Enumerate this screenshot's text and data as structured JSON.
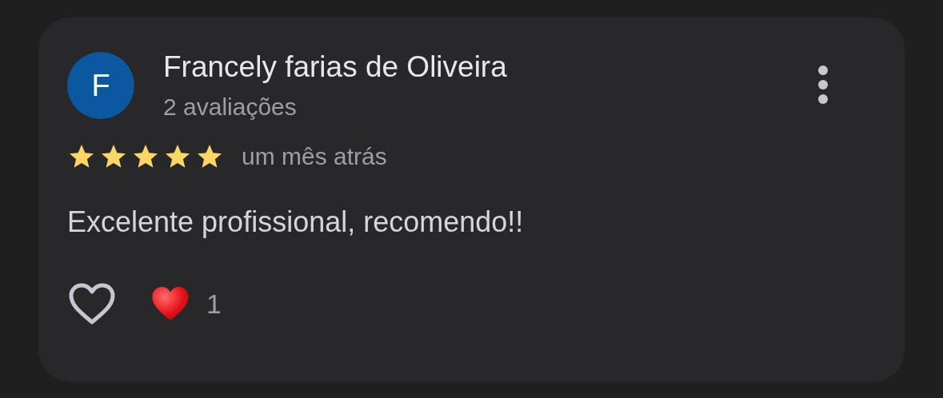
{
  "review": {
    "avatar_letter": "F",
    "author": "Francely farias de Oliveira",
    "review_count": "2 avaliações",
    "stars": 5,
    "time": "um mês atrás",
    "text": "Excelente profissional, recomendo!!",
    "reactions": [
      {
        "kind": "like"
      },
      {
        "kind": "heart",
        "count": "1"
      }
    ]
  }
}
